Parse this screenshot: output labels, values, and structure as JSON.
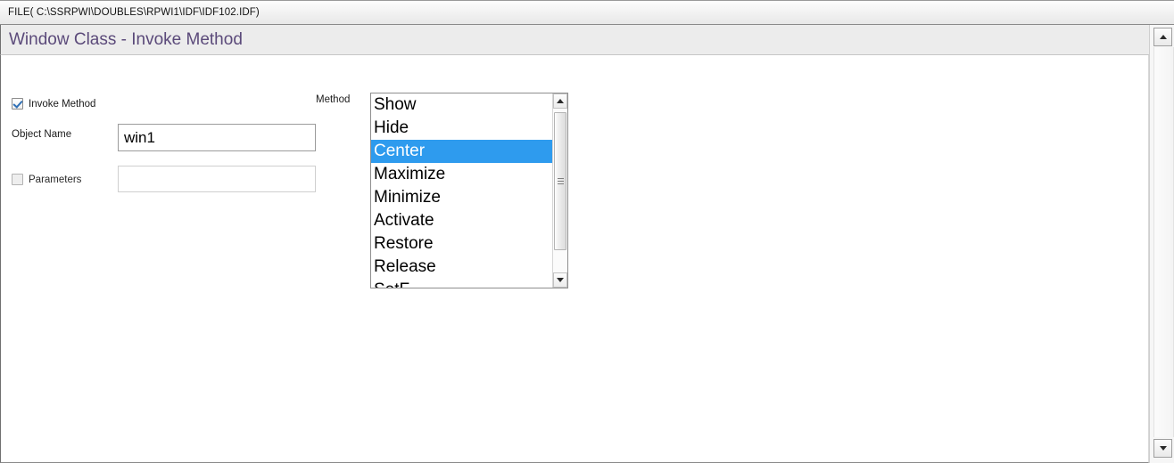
{
  "filebar": {
    "path": "FILE( C:\\SSRPWI\\DOUBLES\\RPWI1\\IDF\\IDF102.IDF)"
  },
  "header": {
    "title": "Window Class - Invoke Method",
    "title_color": "#5b4a7a"
  },
  "form": {
    "invoke_method": {
      "label": "Invoke Method",
      "checked": true
    },
    "object_name": {
      "label": "Object Name",
      "value": "win1",
      "placeholder": ""
    },
    "parameters": {
      "label": "Parameters",
      "checked": false,
      "value": "",
      "placeholder": ""
    }
  },
  "method_list": {
    "label": "Method",
    "selected": "Center",
    "selection_color": "#2e9bee",
    "items": [
      {
        "label": "Show"
      },
      {
        "label": "Hide"
      },
      {
        "label": "Center"
      },
      {
        "label": "Maximize"
      },
      {
        "label": "Minimize"
      },
      {
        "label": "Activate"
      },
      {
        "label": "Restore"
      },
      {
        "label": "Release"
      },
      {
        "label": "SetF"
      }
    ],
    "scrollbar": {
      "up_icon": "arrow-up-icon",
      "down_icon": "arrow-down-icon",
      "grip_icon": "scroll-grip-icon"
    }
  },
  "window_scrollbar": {
    "up_icon": "arrow-up-icon",
    "down_icon": "arrow-down-icon"
  }
}
